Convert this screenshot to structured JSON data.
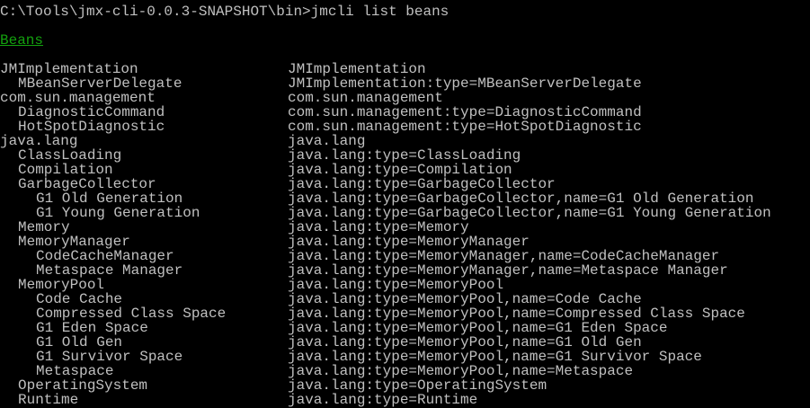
{
  "terminal": {
    "command": "C:\\Tools\\jmx-cli-0.0.3-SNAPSHOT\\bin>jmcli list beans",
    "heading": "Beans",
    "heading_color": "#13a10e",
    "text_color": "#c0c0c0",
    "background_color": "#000000"
  },
  "beans": [
    {
      "name": "JMImplementation",
      "object_name": "JMImplementation",
      "level": 0
    },
    {
      "name": "MBeanServerDelegate",
      "object_name": "JMImplementation:type=MBeanServerDelegate",
      "level": 1
    },
    {
      "name": "com.sun.management",
      "object_name": "com.sun.management",
      "level": 0
    },
    {
      "name": "DiagnosticCommand",
      "object_name": "com.sun.management:type=DiagnosticCommand",
      "level": 1
    },
    {
      "name": "HotSpotDiagnostic",
      "object_name": "com.sun.management:type=HotSpotDiagnostic",
      "level": 1
    },
    {
      "name": "java.lang",
      "object_name": "java.lang",
      "level": 0
    },
    {
      "name": "ClassLoading",
      "object_name": "java.lang:type=ClassLoading",
      "level": 1
    },
    {
      "name": "Compilation",
      "object_name": "java.lang:type=Compilation",
      "level": 1
    },
    {
      "name": "GarbageCollector",
      "object_name": "java.lang:type=GarbageCollector",
      "level": 1
    },
    {
      "name": "G1 Old Generation",
      "object_name": "java.lang:type=GarbageCollector,name=G1 Old Generation",
      "level": 2
    },
    {
      "name": "G1 Young Generation",
      "object_name": "java.lang:type=GarbageCollector,name=G1 Young Generation",
      "level": 2
    },
    {
      "name": "Memory",
      "object_name": "java.lang:type=Memory",
      "level": 1
    },
    {
      "name": "MemoryManager",
      "object_name": "java.lang:type=MemoryManager",
      "level": 1
    },
    {
      "name": "CodeCacheManager",
      "object_name": "java.lang:type=MemoryManager,name=CodeCacheManager",
      "level": 2
    },
    {
      "name": "Metaspace Manager",
      "object_name": "java.lang:type=MemoryManager,name=Metaspace Manager",
      "level": 2
    },
    {
      "name": "MemoryPool",
      "object_name": "java.lang:type=MemoryPool",
      "level": 1
    },
    {
      "name": "Code Cache",
      "object_name": "java.lang:type=MemoryPool,name=Code Cache",
      "level": 2
    },
    {
      "name": "Compressed Class Space",
      "object_name": "java.lang:type=MemoryPool,name=Compressed Class Space",
      "level": 2
    },
    {
      "name": "G1 Eden Space",
      "object_name": "java.lang:type=MemoryPool,name=G1 Eden Space",
      "level": 2
    },
    {
      "name": "G1 Old Gen",
      "object_name": "java.lang:type=MemoryPool,name=G1 Old Gen",
      "level": 2
    },
    {
      "name": "G1 Survivor Space",
      "object_name": "java.lang:type=MemoryPool,name=G1 Survivor Space",
      "level": 2
    },
    {
      "name": "Metaspace",
      "object_name": "java.lang:type=MemoryPool,name=Metaspace",
      "level": 2
    },
    {
      "name": "OperatingSystem",
      "object_name": "java.lang:type=OperatingSystem",
      "level": 1
    },
    {
      "name": "Runtime",
      "object_name": "java.lang:type=Runtime",
      "level": 1
    }
  ]
}
